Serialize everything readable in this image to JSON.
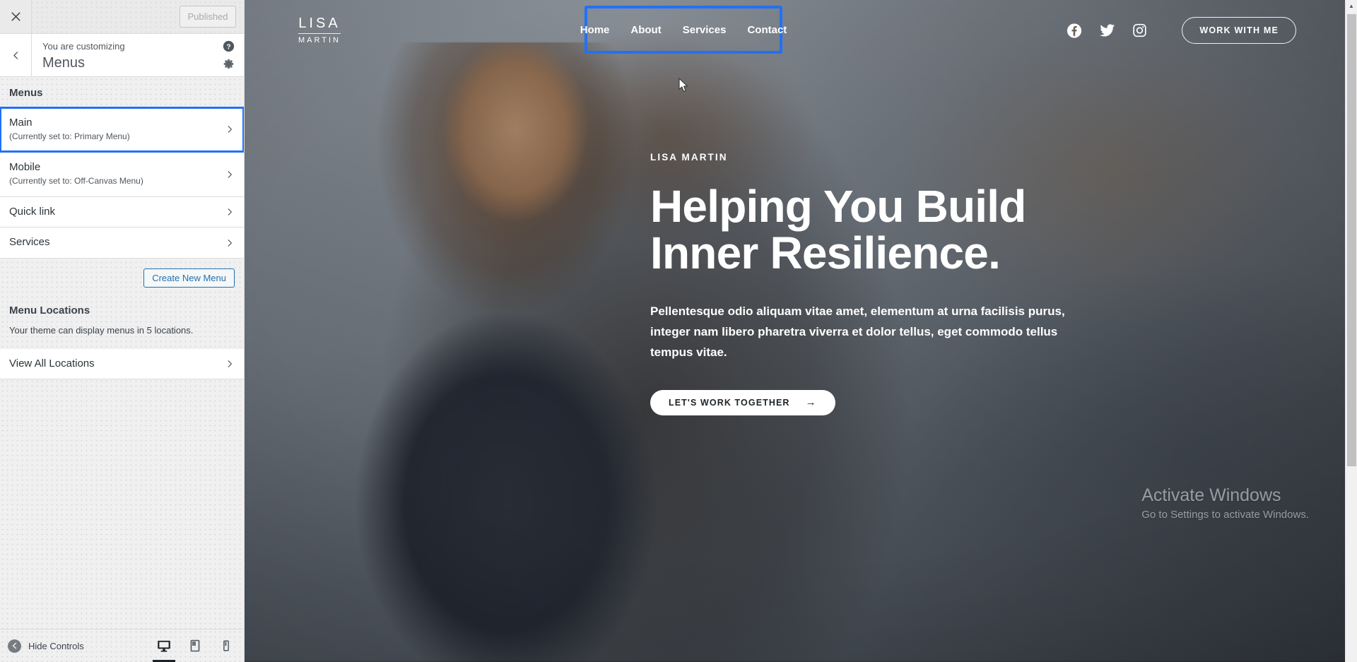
{
  "customizer": {
    "topbar": {
      "close_icon": "close-icon",
      "publish_label": "Published"
    },
    "header": {
      "back_icon": "chevron-left-icon",
      "subtitle": "You are customizing",
      "title": "Menus",
      "help_icon": "help-icon",
      "settings_icon": "gear-icon"
    },
    "menus_section": {
      "title": "Menus",
      "items": [
        {
          "label": "Main",
          "sub": "(Currently set to: Primary Menu)",
          "selected": true
        },
        {
          "label": "Mobile",
          "sub": "(Currently set to: Off-Canvas Menu)",
          "selected": false
        },
        {
          "label": "Quick link",
          "sub": "",
          "selected": false
        },
        {
          "label": "Services",
          "sub": "",
          "selected": false
        }
      ],
      "create_button": "Create New Menu"
    },
    "locations_section": {
      "title": "Menu Locations",
      "description": "Your theme can display menus in 5 locations.",
      "view_all_label": "View All Locations"
    },
    "bottom": {
      "collapse_label": "Hide Controls",
      "collapse_icon": "collapse-arrow-icon",
      "devices": [
        {
          "name": "desktop",
          "active": true
        },
        {
          "name": "tablet",
          "active": false
        },
        {
          "name": "mobile",
          "active": false
        }
      ]
    },
    "accent_color": "#2271f5",
    "link_color": "#2271b1"
  },
  "preview": {
    "brand": {
      "line1": "LISA",
      "line2": "MARTIN"
    },
    "nav": [
      {
        "label": "Home"
      },
      {
        "label": "About"
      },
      {
        "label": "Services"
      },
      {
        "label": "Contact"
      }
    ],
    "social": [
      {
        "name": "facebook-icon"
      },
      {
        "name": "twitter-icon"
      },
      {
        "name": "instagram-icon"
      }
    ],
    "header_cta": "WORK WITH ME",
    "hero": {
      "eyebrow": "LISA MARTIN",
      "heading_line1": "Helping You Build",
      "heading_line2": "Inner Resilience.",
      "paragraph": "Pellentesque odio aliquam vitae amet, elementum at urna facilisis purus, integer nam libero pharetra viverra et dolor tellus, eget commodo tellus tempus vitae.",
      "button_label": "LET'S WORK TOGETHER",
      "button_arrow": "→"
    }
  },
  "watermark": {
    "line1": "Activate Windows",
    "line2": "Go to Settings to activate Windows."
  }
}
